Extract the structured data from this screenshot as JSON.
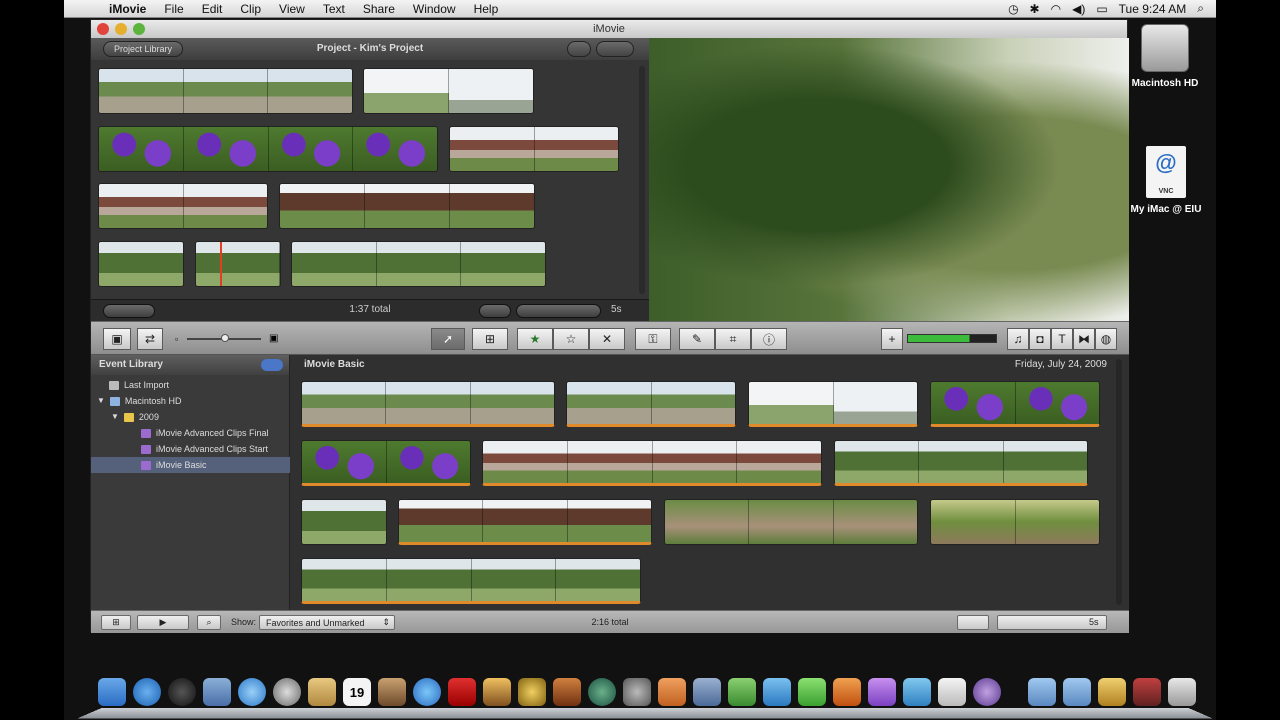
{
  "menubar": {
    "app": "iMovie",
    "items": [
      "File",
      "Edit",
      "Clip",
      "View",
      "Text",
      "Share",
      "Window",
      "Help"
    ],
    "time": "Tue 9:24 AM"
  },
  "window": {
    "title": "iMovie"
  },
  "project": {
    "library_button": "Project Library",
    "title": "Project - Kim's Project",
    "total": "1:37 total",
    "duration": "5s"
  },
  "event_library": {
    "header": "Event Library",
    "items": [
      "Last Import",
      "Macintosh HD",
      "2009",
      "iMovie Advanced Clips Final",
      "iMovie Advanced Clips Start",
      "iMovie Basic"
    ]
  },
  "event_browser": {
    "title": "iMovie Basic",
    "date": "Friday, July 24, 2009"
  },
  "statusbar": {
    "show_label": "Show:",
    "show_value": "Favorites and Unmarked",
    "total": "2:16 total",
    "duration": "5s"
  },
  "desktop": {
    "icons": [
      {
        "label": "Macintosh HD"
      },
      {
        "label": "My iMac @ EIU"
      }
    ],
    "vnc_label": "VNC"
  },
  "colors": {
    "accent_select": "#55607a",
    "toolbar": "#a0a0a0",
    "clip_orange": "#e08a2c"
  },
  "dock": {
    "calendar_day": "19"
  }
}
